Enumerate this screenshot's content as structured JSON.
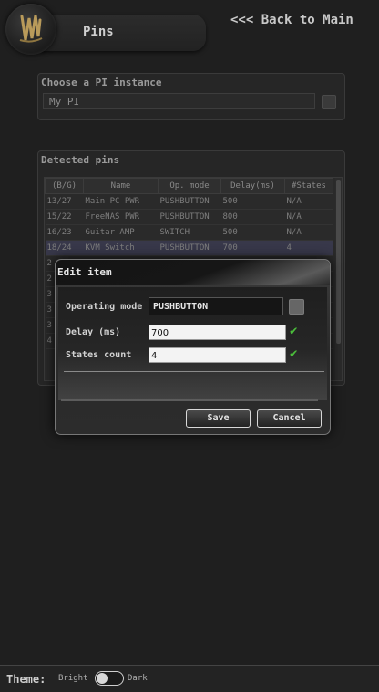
{
  "header": {
    "page_title": "Pins",
    "back_link": "<<< Back to Main"
  },
  "pi_panel": {
    "label": "Choose a PI instance",
    "selected_pi": "My PI"
  },
  "pins_panel": {
    "label": "Detected pins",
    "columns": [
      "(B/G)",
      "Name",
      "Op. mode",
      "Delay(ms)",
      "#States"
    ],
    "rows": [
      [
        "13/27",
        "Main PC PWR",
        "PUSHBUTTON",
        "500",
        "N/A"
      ],
      [
        "15/22",
        "FreeNAS PWR",
        "PUSHBUTTON",
        "800",
        "N/A"
      ],
      [
        "16/23",
        "Guitar AMP",
        "SWITCH",
        "500",
        "N/A"
      ],
      [
        "18/24",
        "KVM Switch",
        "PUSHBUTTON",
        "700",
        "4"
      ],
      [
        "2",
        "",
        "",
        "",
        ""
      ],
      [
        "2",
        "",
        "",
        "",
        ""
      ],
      [
        "3",
        "",
        "",
        "",
        ""
      ],
      [
        "3",
        "",
        "",
        "",
        ""
      ],
      [
        "3",
        "",
        "",
        "",
        ""
      ],
      [
        "4",
        "",
        "",
        "",
        ""
      ]
    ],
    "selected_row_index": 3
  },
  "modal": {
    "title": "Edit item",
    "operating_mode_label": "Operating mode",
    "operating_mode_value": "PUSHBUTTON",
    "delay_label": "Delay (ms)",
    "delay_value": "700",
    "states_label": "States count",
    "states_value": "4",
    "save_label": "Save",
    "cancel_label": "Cancel"
  },
  "footer": {
    "theme_label": "Theme:",
    "bright_label": "Bright",
    "dark_label": "Dark"
  },
  "colors": {
    "background": "#1f1f1f",
    "checkmark": "#4bbd3b",
    "selected_row": "#38384a"
  },
  "icons": [
    "logo-icon",
    "checkmark-icon",
    "dropdown-icon"
  ]
}
